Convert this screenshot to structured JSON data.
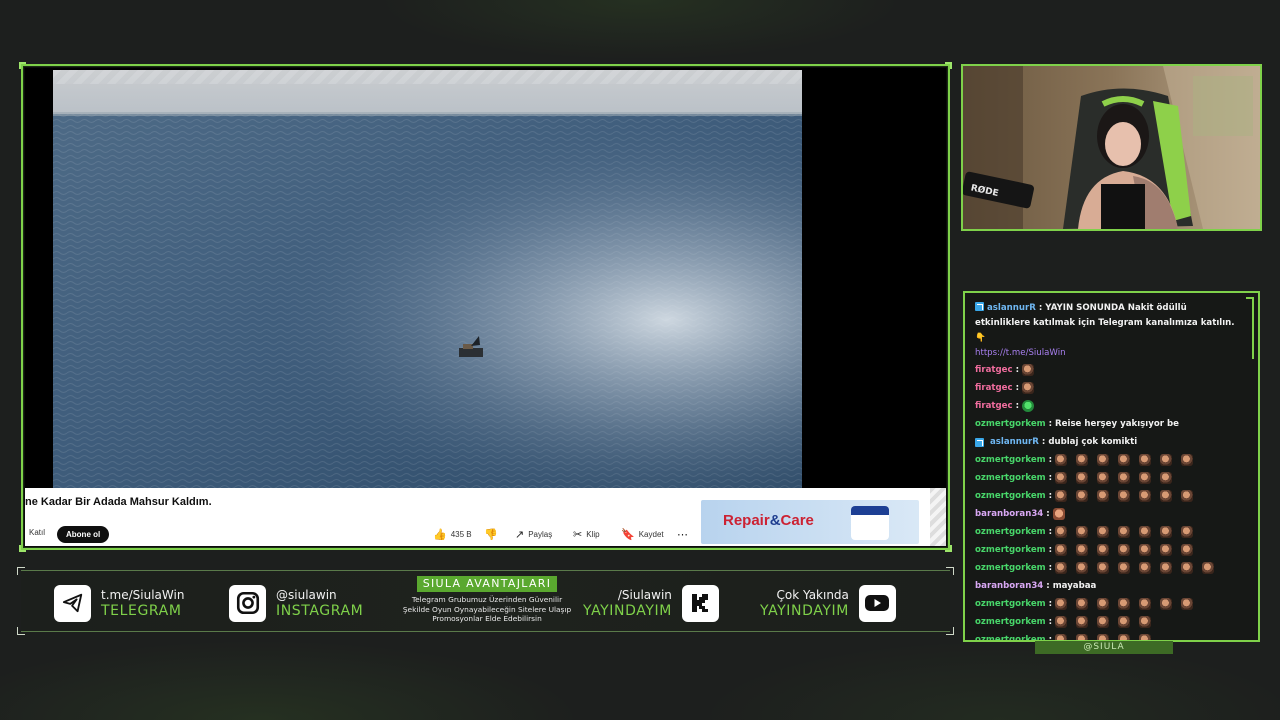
{
  "video": {
    "title": "ne Kadar Bir Adada Mahsur Kaldım.",
    "join_label": "Katıl",
    "subscribe_label": "Abone ol",
    "like_count": "435 B",
    "share_label": "Paylaş",
    "clip_label": "Klip",
    "save_label": "Kaydet",
    "more_label": "⋯",
    "ad_text_a": "Repair",
    "ad_text_amp": "&",
    "ad_text_b": "Care"
  },
  "chat": {
    "messages": [
      {
        "user": "aslannurR",
        "badge": true,
        "color": "blue",
        "text": "YAYIN SONUNDA Nakit ödüllü etkinliklere katılmak için Telegram kanalımıza katılın.👇",
        "link": "https://t.me/SiulaWin",
        "multi": true
      },
      {
        "user": "firatgec",
        "color": "pink",
        "emotes": 1
      },
      {
        "user": "firatgec",
        "color": "pink",
        "emotes": 1
      },
      {
        "user": "firatgec",
        "color": "pink",
        "emotes": 1,
        "emote_style": "green"
      },
      {
        "user": "ozmertgorkem",
        "color": "green",
        "text": "Reise herşey yakışıyor be"
      },
      {
        "user": "aslannurR",
        "badge": true,
        "color": "blue",
        "text": "dublaj çok komikti"
      },
      {
        "user": "ozmertgorkem",
        "color": "green",
        "emotes": 7
      },
      {
        "user": "ozmertgorkem",
        "color": "green",
        "emotes": 6
      },
      {
        "user": "ozmertgorkem",
        "color": "green",
        "emotes": 7
      },
      {
        "user": "baranboran34",
        "color": "lav",
        "emotes": 1,
        "emote_style": "face"
      },
      {
        "user": "ozmertgorkem",
        "color": "green",
        "emotes": 7
      },
      {
        "user": "ozmertgorkem",
        "color": "green",
        "emotes": 7
      },
      {
        "user": "ozmertgorkem",
        "color": "green",
        "emotes": 8
      },
      {
        "user": "baranboran34",
        "color": "lav",
        "text": "mayabaa"
      },
      {
        "user": "ozmertgorkem",
        "color": "green",
        "emotes": 7
      },
      {
        "user": "ozmertgorkem",
        "color": "green",
        "emotes": 5
      },
      {
        "user": "ozmertgorkem",
        "color": "green",
        "emotes": 5
      }
    ]
  },
  "overlay": {
    "handle": "@SIULA",
    "telegram_line1": "t.me/SiulaWin",
    "telegram_line2": "TELEGRAM",
    "instagram_line1": "@siulawin",
    "instagram_line2": "INSTAGRAM",
    "avantaj_title": "SIULA AVANTAJLARI",
    "avantaj_desc": "Telegram Grubumuz Üzerinden Güvenilir Şekilde Oyun Oynayabileceğin Sitelere Ulaşıp Promosyonlar Elde Edebilirsin",
    "kick_line1": "/Siulawin",
    "kick_line2": "YAYINDAYIM",
    "youtube_line1": "Çok Yakında",
    "youtube_line2": "YAYINDAYIM"
  },
  "colors": {
    "accent": "#7fd14a",
    "background": "#1d1f1e",
    "chat_blue": "#6fb7f2",
    "chat_pink": "#f06d9e",
    "chat_green": "#48d66a",
    "chat_lavender": "#d9a8f4"
  }
}
